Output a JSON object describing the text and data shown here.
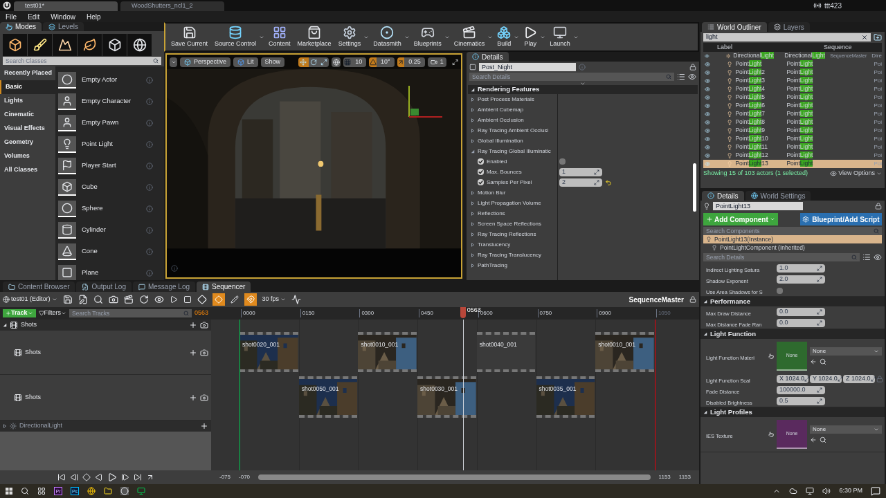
{
  "title_tabs": [
    {
      "label": "test01*",
      "selected": true
    },
    {
      "label": "WoodShutters_ncl1_2",
      "selected": false
    }
  ],
  "user": "ttt423",
  "menu": [
    "File",
    "Edit",
    "Window",
    "Help"
  ],
  "modes": {
    "tabs": [
      {
        "label": "Modes",
        "selected": true
      },
      {
        "label": "Levels",
        "selected": false
      }
    ],
    "search_placeholder": "Search Classes",
    "categories": [
      {
        "label": "Recently Placed",
        "selected": false
      },
      {
        "label": "Basic",
        "selected": true
      },
      {
        "label": "Lights",
        "selected": false
      },
      {
        "label": "Cinematic",
        "selected": false
      },
      {
        "label": "Visual Effects",
        "selected": false
      },
      {
        "label": "Geometry",
        "selected": false
      },
      {
        "label": "Volumes",
        "selected": false
      },
      {
        "label": "All Classes",
        "selected": false
      }
    ],
    "items": [
      "Empty Actor",
      "Empty Character",
      "Empty Pawn",
      "Point Light",
      "Player Start",
      "Cube",
      "Sphere",
      "Cylinder",
      "Cone",
      "Plane"
    ]
  },
  "toolbar": [
    {
      "label": "Save Current",
      "dropdown": false
    },
    {
      "label": "Source Control",
      "dropdown": true
    },
    {
      "label": "Content",
      "dropdown": false
    },
    {
      "label": "Marketplace",
      "dropdown": false
    },
    {
      "label": "Settings",
      "dropdown": true
    },
    {
      "label": "Datasmith",
      "dropdown": true
    },
    {
      "label": "Blueprints",
      "dropdown": true
    },
    {
      "label": "Cinematics",
      "dropdown": true
    },
    {
      "label": "Build",
      "dropdown": true
    },
    {
      "label": "Play",
      "dropdown": true
    },
    {
      "label": "Launch",
      "dropdown": true
    }
  ],
  "viewport": {
    "view": "Perspective",
    "lighting": "Lit",
    "show": "Show",
    "transform_tools": [
      {
        "kind": "move",
        "selected": true
      },
      {
        "kind": "rotate",
        "selected": false
      },
      {
        "kind": "scale",
        "selected": false
      }
    ],
    "grid_snap": {
      "on": false,
      "value": "10"
    },
    "angle_snap": {
      "on": true,
      "value": "10°"
    },
    "scale_snap": {
      "on": true,
      "value": "0.25"
    },
    "camera_speed": "1"
  },
  "details": {
    "tab": "Details",
    "object": "Post_Night",
    "search_placeholder": "Search Details",
    "section": "Rendering Features",
    "rows": [
      {
        "kind": "group",
        "label": "Post Process Materials",
        "expanded": false
      },
      {
        "kind": "group",
        "label": "Ambient Cubemap",
        "expanded": false
      },
      {
        "kind": "group",
        "label": "Ambient Occlusion",
        "expanded": false
      },
      {
        "kind": "group",
        "label": "Ray Tracing Ambient Occlusi",
        "expanded": false
      },
      {
        "kind": "group",
        "label": "Global Illumination",
        "expanded": false
      },
      {
        "kind": "group",
        "label": "Ray Tracing Global Illuminatic",
        "expanded": true
      },
      {
        "kind": "bool",
        "label": "Enabled",
        "checked": true,
        "value": false
      },
      {
        "kind": "number",
        "label": "Max. Bounces",
        "checked": true,
        "value": "1",
        "modified": false
      },
      {
        "kind": "number",
        "label": "Samples Per Pixel",
        "checked": true,
        "value": "2",
        "modified": true
      },
      {
        "kind": "group",
        "label": "Motion Blur",
        "expanded": false
      },
      {
        "kind": "group",
        "label": "Light Propagation Volume",
        "expanded": false
      },
      {
        "kind": "group",
        "label": "Reflections",
        "expanded": false
      },
      {
        "kind": "group",
        "label": "Screen Space Reflections",
        "expanded": false
      },
      {
        "kind": "group",
        "label": "Ray Tracing Reflections",
        "expanded": false
      },
      {
        "kind": "group",
        "label": "Translucency",
        "expanded": false
      },
      {
        "kind": "group",
        "label": "Ray Tracing Translucency",
        "expanded": false
      },
      {
        "kind": "group",
        "label": "PathTracing",
        "expanded": false
      }
    ]
  },
  "outliner": {
    "tabs": [
      {
        "label": "World Outliner",
        "selected": true
      },
      {
        "label": "Layers",
        "selected": false
      }
    ],
    "search": "light",
    "columns": [
      "Label",
      "Sequence"
    ],
    "rows": [
      {
        "label": [
          "Directional",
          "Light"
        ],
        "type": [
          "Directional",
          "Light"
        ],
        "sequence": "SequenceMaster",
        "column_4": "Dire",
        "selected": false
      },
      {
        "label": [
          "Point",
          "Light"
        ],
        "type": [
          "Point",
          "Light"
        ],
        "column_4": "Poi",
        "selected": false
      },
      {
        "label": [
          "Point",
          "Light",
          "2"
        ],
        "type": [
          "Point",
          "Light"
        ],
        "column_4": "Poi",
        "selected": false
      },
      {
        "label": [
          "Point",
          "Light",
          "3"
        ],
        "type": [
          "Point",
          "Light"
        ],
        "column_4": "Poi",
        "selected": false
      },
      {
        "label": [
          "Point",
          "Light",
          "4"
        ],
        "type": [
          "Point",
          "Light"
        ],
        "column_4": "Poi",
        "selected": false
      },
      {
        "label": [
          "Point",
          "Light",
          "5"
        ],
        "type": [
          "Point",
          "Light"
        ],
        "column_4": "Poi",
        "selected": false
      },
      {
        "label": [
          "Point",
          "Light",
          "6"
        ],
        "type": [
          "Point",
          "Light"
        ],
        "column_4": "Poi",
        "selected": false
      },
      {
        "label": [
          "Point",
          "Light",
          "7"
        ],
        "type": [
          "Point",
          "Light"
        ],
        "column_4": "Poi",
        "selected": false
      },
      {
        "label": [
          "Point",
          "Light",
          "8"
        ],
        "type": [
          "Point",
          "Light"
        ],
        "column_4": "Poi",
        "selected": false
      },
      {
        "label": [
          "Point",
          "Light",
          "9"
        ],
        "type": [
          "Point",
          "Light"
        ],
        "column_4": "Poi",
        "selected": false
      },
      {
        "label": [
          "Point",
          "Light",
          "10"
        ],
        "type": [
          "Point",
          "Light"
        ],
        "column_4": "Poi",
        "selected": false
      },
      {
        "label": [
          "Point",
          "Light",
          "11"
        ],
        "type": [
          "Point",
          "Light"
        ],
        "column_4": "Poi",
        "selected": false
      },
      {
        "label": [
          "Point",
          "Light",
          "12"
        ],
        "type": [
          "Point",
          "Light"
        ],
        "column_4": "Poi",
        "selected": false
      },
      {
        "label": [
          "Point",
          "Light",
          "13"
        ],
        "type": [
          "Point",
          "Light"
        ],
        "column_4": "Poi",
        "selected": true
      }
    ],
    "status": "Showing 15 of 103 actors (1 selected)",
    "view_options": "View Options"
  },
  "actor_details": {
    "tabs": [
      {
        "label": "Details",
        "selected": true
      },
      {
        "label": "World Settings",
        "selected": false
      }
    ],
    "object": "PointLight13",
    "add_component": "Add Component",
    "blueprint": "Blueprint/Add Script",
    "components_placeholder": "Search Components",
    "components": [
      {
        "label": "PointLight13(Instance)",
        "selected": true
      },
      {
        "label": "PointLightComponent (Inherited)",
        "selected": false
      }
    ],
    "search_placeholder": "Search Details",
    "sections": [
      {
        "rows": [
          {
            "kind": "number",
            "label": "Indirect Lighting Satura",
            "value": "1.0"
          },
          {
            "kind": "number",
            "label": "Shadow Exponent",
            "value": "2.0"
          },
          {
            "kind": "bool",
            "label": "Use Area Shadows for S",
            "value": false
          }
        ]
      },
      {
        "title": "Performance",
        "expanded": true,
        "rows": [
          {
            "kind": "number",
            "label": "Max Draw Distance",
            "value": "0.0"
          },
          {
            "kind": "number",
            "label": "Max Distance Fade Ran",
            "value": "0.0"
          }
        ]
      },
      {
        "title": "Light Function",
        "expanded": true,
        "rows": [
          {
            "kind": "asset",
            "label": "Light Function Materi",
            "color": "#2e6a2e",
            "swatch": "None",
            "value": "None"
          },
          {
            "kind": "vector",
            "label": "Light Function Scal",
            "values": [
              "X  1024.0",
              "Y  1024.0",
              "Z  1024.0"
            ]
          },
          {
            "kind": "number",
            "label": "Fade Distance",
            "value": "100000.0"
          },
          {
            "kind": "number",
            "label": "Disabled Brightness",
            "value": "0.5"
          }
        ]
      },
      {
        "title": "Light Profiles",
        "expanded": true,
        "rows": [
          {
            "kind": "asset",
            "label": "IES Texture",
            "color": "#5a2a5e",
            "swatch": "None",
            "value": "None"
          }
        ]
      }
    ]
  },
  "sequencer": {
    "tabs": [
      {
        "label": "Content Browser",
        "selected": false
      },
      {
        "label": "Output Log",
        "selected": false
      },
      {
        "label": "Message Log",
        "selected": false
      },
      {
        "label": "Sequencer",
        "selected": true
      }
    ],
    "world": "test01 (Editor)",
    "key_toggle": {
      "on": true
    },
    "snap_toggle": {
      "on": true
    },
    "fps": "30 fps",
    "sequence": "SequenceMaster",
    "track_button": "Track",
    "filters": "Filters",
    "search_placeholder": "Search Tracks",
    "current_frame": "0563",
    "ticks": [
      "0000",
      "0150",
      "0300",
      "0450",
      "0600",
      "0750",
      "0900",
      "1050"
    ],
    "playhead": {
      "label": "0563",
      "level": 0.516
    },
    "tracks": [
      {
        "label": "Shots",
        "expanded": true,
        "children": [
          {
            "label": "Shots",
            "clips": [
              {
                "kind": "picture",
                "name": "shot0020_001"
              },
              {
                "kind": "gap"
              },
              {
                "kind": "picture",
                "name": "shot0010_001"
              },
              {
                "kind": "gap"
              },
              {
                "kind": "blank",
                "name": "shot0040_001"
              },
              {
                "kind": "gap"
              },
              {
                "kind": "picture",
                "name": "shot0010_001"
              }
            ]
          },
          {
            "label": "Shots",
            "clips": [
              {
                "kind": "gap"
              },
              {
                "kind": "picture",
                "name": "shot0050_001"
              },
              {
                "kind": "gap"
              },
              {
                "kind": "picture",
                "name": "shot0030_001"
              },
              {
                "kind": "gap"
              },
              {
                "kind": "picture",
                "name": "shot0035_001"
              }
            ]
          }
        ]
      },
      {
        "label": "DirectionalLight",
        "expanded": false
      }
    ],
    "range": [
      "-075",
      "-070",
      "1153",
      "1153"
    ]
  },
  "taskbar_apps": [
    "Pr",
    "Ps"
  ],
  "clock": "6:30 PM"
}
